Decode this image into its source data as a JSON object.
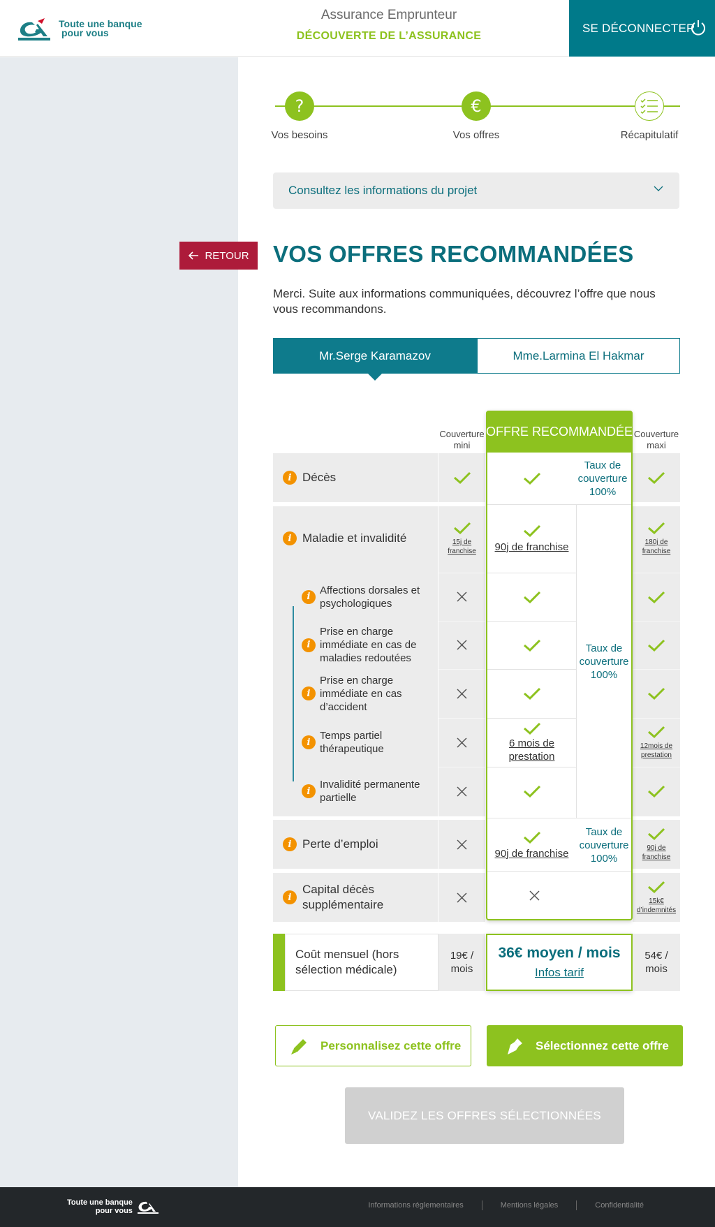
{
  "header": {
    "logo_line1": "Toute une banque",
    "logo_line2": "pour vous",
    "title": "Assurance Emprunteur",
    "subtitle": "DÉCOUVERTE DE L’ASSURANCE",
    "logout_label": "SE DÉCONNECTER"
  },
  "stepper": {
    "steps": [
      {
        "label": "Vos besoins",
        "icon": "?",
        "state": "done"
      },
      {
        "label": "Vos offres",
        "icon": "€",
        "state": "active"
      },
      {
        "label": "Récapitulatif",
        "icon": "checklist-icon",
        "state": "future"
      }
    ]
  },
  "project": {
    "label": "Consultez les informations du projet"
  },
  "back_label": "RETOUR",
  "title": "VOS OFFRES RECOMMANDÉES",
  "intro": "Merci. Suite aux informations communiquées, découvrez l’offre que nous vous recommandons.",
  "tabs": [
    {
      "label": "Mr.Serge Karamazov",
      "active": true
    },
    {
      "label": "Mme.Larmina El Hakmar",
      "active": false
    }
  ],
  "table": {
    "col_mini": "Couverture mini",
    "col_rec": "OFFRE RECOMMANDÉE",
    "col_maxi": "Couverture maxi",
    "rows": {
      "deces": {
        "label": "Décès",
        "taux": "Taux de couverture 100%"
      },
      "maladie": {
        "label": "Maladie et invalidité",
        "mini_note": "15j de franchise",
        "rec_note": "90j de franchise",
        "maxi_note": "180j de franchise",
        "taux": "Taux de couverture 100%"
      },
      "dorsales": {
        "label": "Affections dorsales et psychologiques"
      },
      "redoutees": {
        "label": "Prise en charge immédiate en cas de maladies redoutées"
      },
      "accident": {
        "label": "Prise en charge immédiate en cas d’accident"
      },
      "temps": {
        "label": "Temps partiel thérapeutique",
        "rec_note": "6 mois de prestation",
        "maxi_note": "12mois de prestation"
      },
      "ipp": {
        "label": "Invalidité permanente partielle"
      },
      "emploi": {
        "label": "Perte d’emploi",
        "rec_note": "90j de franchise",
        "maxi_note": "90j de franchise",
        "taux": "Taux de couverture 100%"
      },
      "capital": {
        "label": "Capital décès supplémentaire",
        "maxi_note": "15k€ d’indemnités"
      }
    },
    "cost": {
      "label": "Coût mensuel (hors sélection médicale)",
      "mini": "19€ / mois",
      "rec": "36€ moyen / mois",
      "rec_link": "Infos tarif",
      "maxi": "54€ / mois"
    }
  },
  "buttons": {
    "customize": "Personnalisez cette offre",
    "select": "Sélectionnez cette offre",
    "validate": "VALIDEZ LES OFFRES SÉLECTIONNÉES"
  },
  "footer": {
    "logo_line1": "Toute une banque",
    "logo_line2": "pour vous",
    "links": [
      "Informations réglementaires",
      "Mentions légales",
      "Confidentialité"
    ]
  },
  "colors": {
    "primary": "#007a8a",
    "accent": "#8dc21f",
    "back": "#ad1b3a",
    "info": "#f39200"
  }
}
